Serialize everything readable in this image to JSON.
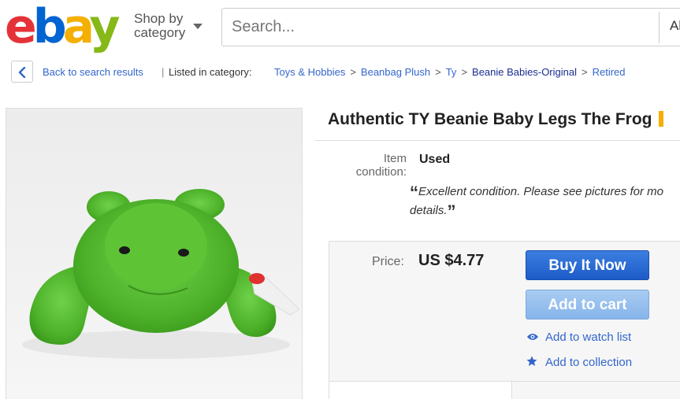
{
  "header": {
    "logo_letters": [
      "e",
      "b",
      "a",
      "y"
    ],
    "shop_by_line1": "Shop by",
    "shop_by_line2": "category",
    "search_placeholder": "Search...",
    "search_category_partial": "Al"
  },
  "breadcrumb": {
    "back_label": "Back to search results",
    "separator": "|",
    "listed_label": "Listed in category:",
    "items": [
      {
        "label": "Toys & Hobbies"
      },
      {
        "label": "Beanbag Plush"
      },
      {
        "label": "Ty"
      },
      {
        "label": "Beanie Babies-Original"
      },
      {
        "label": "Retired"
      }
    ],
    "item_separator": ">"
  },
  "product": {
    "title": "Authentic TY Beanie Baby Legs The Frog",
    "condition_label_line1": "Item",
    "condition_label_line2": "condition:",
    "condition_value": "Used",
    "condition_note_line1": "Excellent condition. Please see pictures for mo",
    "condition_note_line2": "details.",
    "price_label": "Price:",
    "price_value": "US $4.77"
  },
  "actions": {
    "buy_now": "Buy It Now",
    "add_to_cart": "Add to cart",
    "watch_list": "Add to watch list",
    "collection": "Add to collection"
  },
  "colors": {
    "ebay_red": "#e53238",
    "ebay_blue": "#0064d2",
    "ebay_yellow": "#f5af02",
    "ebay_green": "#86b817",
    "link_blue": "#3366cc",
    "buy_blue": "#1d5bc8",
    "frog_green": "#52b82a"
  },
  "icons": {
    "back": "chevron-left-icon",
    "search_category": "chevron-down-icon",
    "watch": "eye-icon",
    "collection": "star-icon"
  }
}
